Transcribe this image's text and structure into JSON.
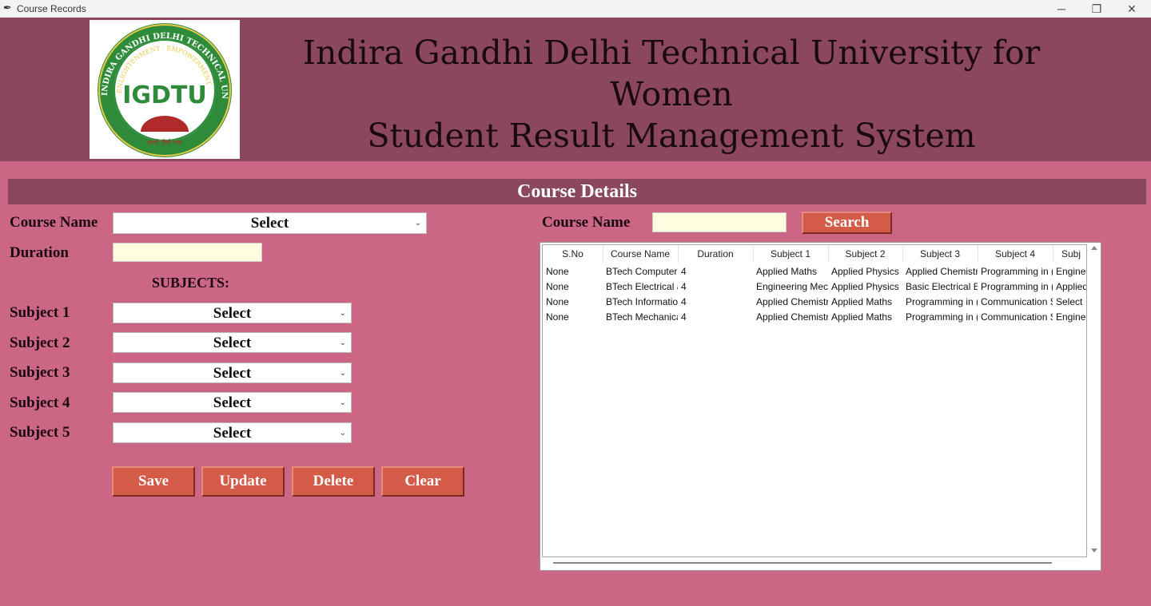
{
  "window": {
    "title": "Course Records",
    "icon": "feather-icon",
    "controls": [
      "minimize-icon",
      "restore-icon",
      "close-icon"
    ]
  },
  "header": {
    "logo_text_top": "INDIRA GANDHI DELHI TECHNICAL UNIVERSITY FOR WOMEN",
    "logo_text_mid": "ENLIGHTENMENT · EMPOWERMENT · EDUCATION",
    "logo_monogram": "IGDTU",
    "logo_motto": "आपो दीपो भवः",
    "title_line1": "Indira Gandhi Delhi Technical University for Women",
    "title_line2": "Student Result Management System"
  },
  "section": {
    "title": "Course Details"
  },
  "form": {
    "course_name_label": "Course Name",
    "course_name_value": "Select",
    "duration_label": "Duration",
    "duration_value": "",
    "subjects_heading": "SUBJECTS:",
    "subjects": [
      {
        "label": "Subject 1",
        "value": "Select"
      },
      {
        "label": "Subject 2",
        "value": "Select"
      },
      {
        "label": "Subject 3",
        "value": "Select"
      },
      {
        "label": "Subject 4",
        "value": "Select"
      },
      {
        "label": "Subject 5",
        "value": "Select"
      }
    ],
    "buttons": {
      "save": "Save",
      "update": "Update",
      "delete": "Delete",
      "clear": "Clear"
    }
  },
  "search": {
    "label": "Course Name",
    "value": "",
    "button": "Search"
  },
  "table": {
    "columns": [
      "S.No",
      "Course Name",
      "Duration",
      "Subject 1",
      "Subject 2",
      "Subject 3",
      "Subject 4",
      "Subj"
    ],
    "rows": [
      [
        "None",
        "BTech Computer",
        "4",
        "Applied Maths",
        "Applied Physics",
        "Applied Chemistr",
        "Programming in (",
        "Engineer"
      ],
      [
        "None",
        "BTech Electrical a",
        "4",
        "Engineering Mecl",
        "Applied Physics",
        "Basic Electrical En",
        "Programming in (",
        "Applied"
      ],
      [
        "None",
        "BTech Informatio",
        "4",
        "Applied Chemistr",
        "Applied Maths",
        "Programming in (",
        "Communication S",
        "Select"
      ],
      [
        "None",
        "BTech Mechanica",
        "4",
        "Applied Chemistr",
        "Applied Maths",
        "Programming in (",
        "Communication S",
        "Engineer"
      ]
    ]
  },
  "colors": {
    "background": "#cc6685",
    "header": "#8b4760",
    "button": "#d35b48",
    "entry": "#fffde0"
  }
}
